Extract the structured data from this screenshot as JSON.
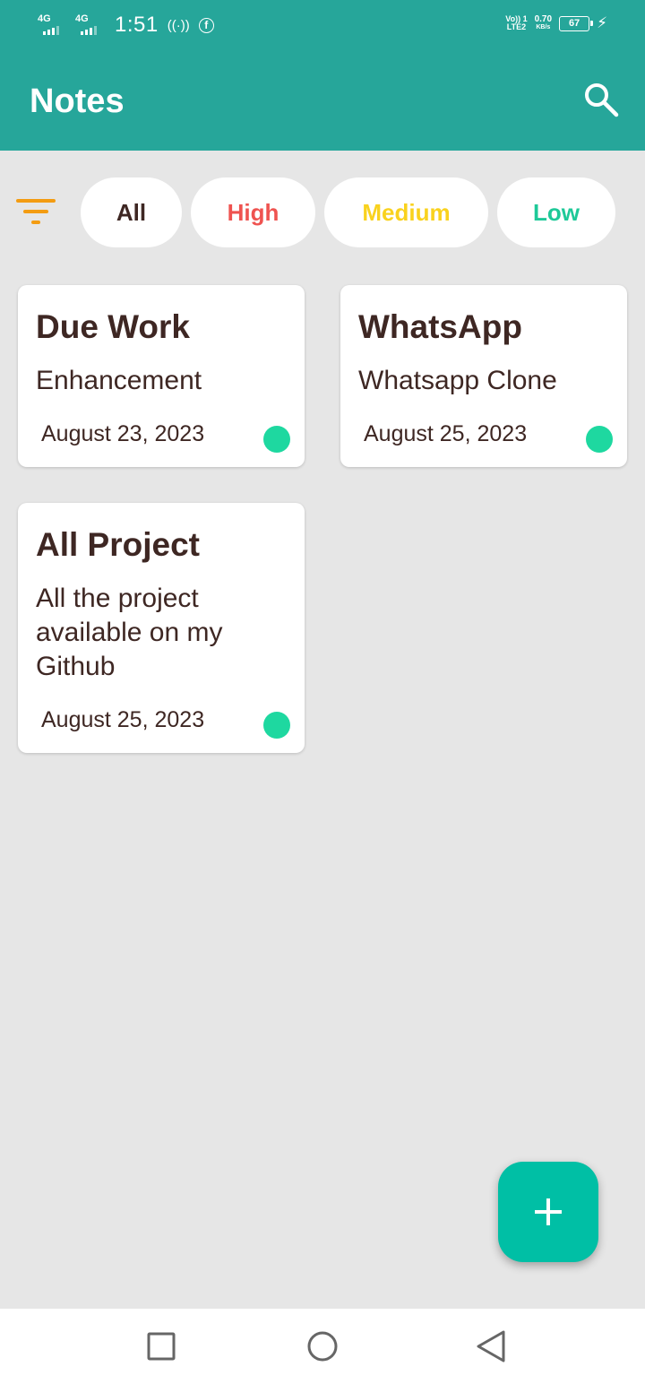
{
  "status_bar": {
    "network1": "4G",
    "network2": "4G",
    "time": "1:51",
    "hotspot_icon": "hotspot-icon",
    "facebook_glyph": "f",
    "volte_line1": "Vo)) 1",
    "volte_line2": "LTE2",
    "speed_value": "0.70",
    "speed_unit": "KB/s",
    "battery": "67"
  },
  "app_bar": {
    "title": "Notes",
    "search_icon": "search-icon"
  },
  "filters": {
    "icon": "filter-icon",
    "chips": [
      {
        "label": "All",
        "color": "#3e2723"
      },
      {
        "label": "High",
        "color": "#ef5350"
      },
      {
        "label": "Medium",
        "color": "#f9d21e"
      },
      {
        "label": "Low",
        "color": "#1ec998"
      }
    ]
  },
  "notes": [
    {
      "title": "Due Work",
      "subtitle": "Enhancement",
      "date": "August 23, 2023",
      "priority_color": "#1ed8a0"
    },
    {
      "title": "WhatsApp",
      "subtitle": "Whatsapp Clone",
      "date": "August 25, 2023",
      "priority_color": "#1ed8a0"
    },
    {
      "title": "All Project",
      "subtitle": "All the project available on my Github",
      "date": "August 25, 2023",
      "priority_color": "#1ed8a0"
    }
  ],
  "fab": {
    "icon": "plus-icon",
    "color": "#00bfa5"
  },
  "nav_bar": {
    "recent_icon": "square-icon",
    "home_icon": "circle-icon",
    "back_icon": "triangle-back-icon"
  },
  "colors": {
    "primary": "#26a69a",
    "background": "#e6e6e6",
    "text": "#3e2723"
  }
}
